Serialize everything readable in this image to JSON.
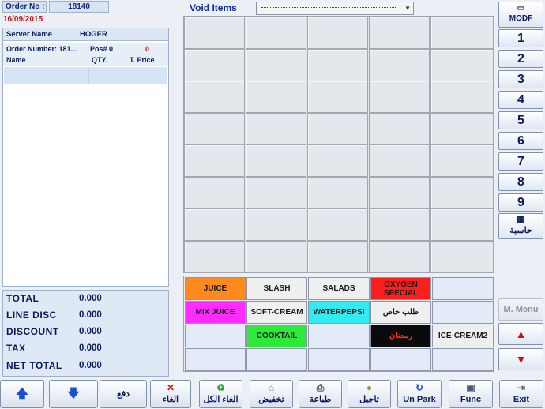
{
  "header": {
    "order_no_label": "Order No :",
    "order_no_value": "18140",
    "date": "16/09/2015"
  },
  "server": {
    "label": "Server Name",
    "value": "HOGER"
  },
  "order_info": {
    "order_number": "Order Number: 181...",
    "pos": "Pos# 0",
    "count": "0"
  },
  "columns": [
    "Name",
    "QTY.",
    "T. Price"
  ],
  "totals": [
    {
      "label": "TOTAL",
      "value": "0.000"
    },
    {
      "label": "LINE DISC",
      "value": "0.000"
    },
    {
      "label": "DISCOUNT",
      "value": "0.000"
    },
    {
      "label": "TAX",
      "value": "0.000"
    },
    {
      "label": "NET TOTAL",
      "value": "0.000"
    }
  ],
  "void_items": {
    "label": "Void Items"
  },
  "categories": [
    {
      "label": "JUICE",
      "bg": "#ff8a1e",
      "fg": "#1a1a1a"
    },
    {
      "label": "SLASH",
      "bg": "#efefef",
      "fg": "#1a1a1a"
    },
    {
      "label": "SALADS",
      "bg": "#efefef",
      "fg": "#1a1a1a"
    },
    {
      "label": "OXYGEN SPECIAL",
      "bg": "#ff1e1e",
      "fg": "#1a1a1a"
    },
    {
      "label": "",
      "bg": "#e2ebf7",
      "fg": "#1a1a1a"
    },
    {
      "label": "MIX JUICE",
      "bg": "#ff2cff",
      "fg": "#1a1a1a"
    },
    {
      "label": "SOFT-CREAM",
      "bg": "#efefef",
      "fg": "#1a1a1a"
    },
    {
      "label": "WATERPEPSI",
      "bg": "#33eaf0",
      "fg": "#1a1a1a"
    },
    {
      "label": "طلب خاص",
      "bg": "#efefef",
      "fg": "#1a1a1a"
    },
    {
      "label": "",
      "bg": "#e2ebf7",
      "fg": "#1a1a1a"
    },
    {
      "label": "",
      "bg": "#e2ebf7",
      "fg": "#1a1a1a"
    },
    {
      "label": "COOKTAIL",
      "bg": "#2ee83a",
      "fg": "#1a1a1a"
    },
    {
      "label": "",
      "bg": "#e2ebf7",
      "fg": "#1a1a1a"
    },
    {
      "label": "رمضان",
      "bg": "#0a0a0a",
      "fg": "#ff2a2a"
    },
    {
      "label": "ICE-CREAM2",
      "bg": "#efefef",
      "fg": "#1a1a1a"
    },
    {
      "label": "",
      "bg": "#e2ebf7",
      "fg": "#1a1a1a"
    },
    {
      "label": "",
      "bg": "#e2ebf7",
      "fg": "#1a1a1a"
    },
    {
      "label": "",
      "bg": "#e2ebf7",
      "fg": "#1a1a1a"
    },
    {
      "label": "",
      "bg": "#e2ebf7",
      "fg": "#1a1a1a"
    },
    {
      "label": "",
      "bg": "#e2ebf7",
      "fg": "#1a1a1a"
    }
  ],
  "numpad": {
    "modf": "MODF",
    "keys": [
      "1",
      "2",
      "3",
      "4",
      "5",
      "6",
      "7",
      "8",
      "9"
    ],
    "calculator": "حاسبة",
    "menu": "M. Menu"
  },
  "bottom": {
    "pay": "دفع",
    "cancel": "الغاء",
    "cancel_all": "الغاء الكل",
    "discount": "تخفيض",
    "print": "طباعة",
    "postpone": "تاجيل",
    "unpark": "Un Park",
    "func": "Func",
    "exit": "Exit"
  }
}
